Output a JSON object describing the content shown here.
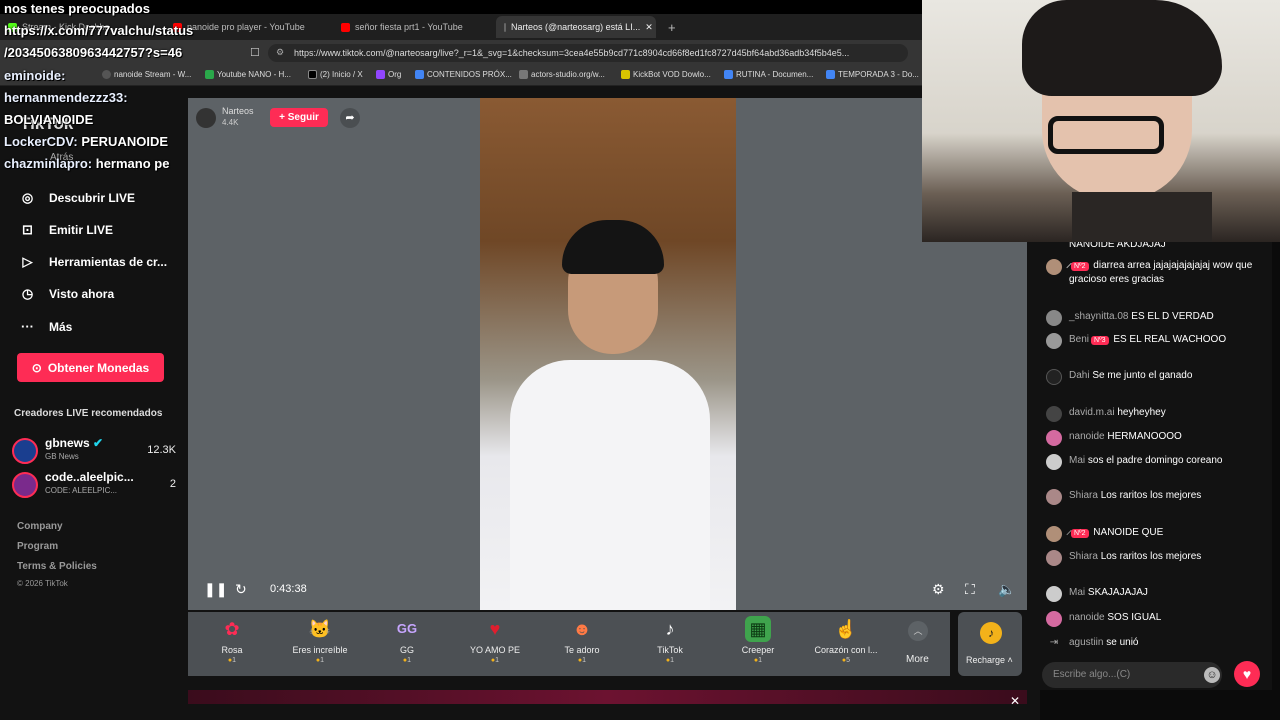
{
  "overlay": {
    "lines": [
      "nos tenes preocupados",
      "https://x.com/777valchu/status",
      "/2034506380963442757?s=46"
    ],
    "chat": [
      {
        "user": "eminoide:",
        "text": ""
      },
      {
        "user": "hernanmendezzz33:",
        "text": "BOLVIANOIDE"
      },
      {
        "user": "LockerCDV:",
        "text": "PERUANOIDE"
      },
      {
        "user": "chazminlapro:",
        "text": "hermano pe"
      }
    ]
  },
  "browser": {
    "tabs": [
      {
        "label": "Stream - Kick Dashbo..."
      },
      {
        "label": "nanoide pro player - YouTube"
      },
      {
        "label": "señor fiesta prt1 - YouTube"
      },
      {
        "label": "Narteos (@narteosarg) está LI..."
      }
    ],
    "url": "https://www.tiktok.com/@narteosarg/live?_r=1&_svg=1&checksum=3cea4e55b9cd771c8904cd66f8ed1fc8727d45bf64abd36adb34f5b4e5...",
    "bookmarks": [
      "nanoide Stream - W...",
      "Youtube NANO - H...",
      "(2) Inicio / X",
      "Org",
      "CONTENIDOS PRÓX...",
      "actors-studio.org/w...",
      "KickBot VOD Dowlo...",
      "RUTINA - Documen...",
      "TEMPORADA 3 - Do..."
    ]
  },
  "sidebar": {
    "logo": "TikTok",
    "back": "Atrás",
    "nav": [
      {
        "label": "Descubrir LIVE",
        "icon": "compass-icon"
      },
      {
        "label": "Emitir LIVE",
        "icon": "broadcast-icon"
      },
      {
        "label": "Herramientas de cr...",
        "icon": "lightbulb-icon"
      },
      {
        "label": "Visto ahora",
        "icon": "history-icon"
      },
      {
        "label": "Más",
        "icon": "more-icon"
      }
    ],
    "coins_button": "Obtener Monedas",
    "recommended_title": "Creadores LIVE recomendados",
    "creators": [
      {
        "name": "gbnews",
        "sub": "GB News",
        "count": "12.3K"
      },
      {
        "name": "code..aleelpic...",
        "sub": "CODE: ALEELPIC...",
        "count": "2"
      }
    ],
    "footer": [
      "Company",
      "Program",
      "Terms & Policies",
      "© 2026 TikTok"
    ]
  },
  "player": {
    "host_name": "Narteos",
    "host_likes": "4.4K",
    "follow_label": "+ Seguir",
    "time": "0:43:38"
  },
  "gifts": [
    {
      "name": "Rosa",
      "price": "1",
      "icon": "rose-icon"
    },
    {
      "name": "Eres increíble",
      "price": "1",
      "icon": "cat-icon"
    },
    {
      "name": "GG",
      "price": "1",
      "icon": "gg-icon"
    },
    {
      "name": "YO AMO PE",
      "price": "1",
      "icon": "heart-gift-icon"
    },
    {
      "name": "Te adoro",
      "price": "1",
      "icon": "kiss-icon"
    },
    {
      "name": "TikTok",
      "price": "1",
      "icon": "tiktok-icon"
    },
    {
      "name": "Creeper",
      "price": "1",
      "icon": "creeper-icon"
    },
    {
      "name": "Corazón con l...",
      "price": "5",
      "icon": "finger-heart-icon"
    }
  ],
  "more_label": "More",
  "recharge_label": "Recharge",
  "chat": {
    "messages": [
      {
        "user": "",
        "text": "NANOIDE AKDJAJAJ",
        "badge": ""
      },
      {
        "user": "̷̷̷",
        "text": "diarrea arrea jajajajajajajaj wow que gracioso eres gracias",
        "badge": "Nº2"
      },
      {
        "user": "_shaynitta.08",
        "text": "ES EL D VERDAD",
        "badge": ""
      },
      {
        "user": "Beni",
        "text": "ES EL REAL WACHOOO",
        "badge": "Nº3"
      },
      {
        "user": "Dahi",
        "text": "Se me junto el ganado",
        "badge": ""
      },
      {
        "user": "david.m.ai",
        "text": "heyheyhey",
        "badge": ""
      },
      {
        "user": "nanoide",
        "text": "HERMANOOOO",
        "badge": ""
      },
      {
        "user": "Mai",
        "text": "sos el padre domingo coreano",
        "badge": ""
      },
      {
        "user": "Shiara",
        "text": "Los raritos los mejores",
        "badge": ""
      },
      {
        "user": "̷",
        "text": "NANOIDE QUE",
        "badge": "Nº2"
      },
      {
        "user": "Shiara",
        "text": "Los raritos los mejores",
        "badge": ""
      },
      {
        "user": "Mai",
        "text": "SKAJAJAJAJ",
        "badge": ""
      },
      {
        "user": "nanoide",
        "text": "SOS IGUAL",
        "badge": ""
      },
      {
        "user": "agustiin",
        "text": "se unió",
        "badge": ""
      }
    ],
    "input_placeholder": "Escribe algo...(C)"
  },
  "colors": {
    "accent": "#fe2c55",
    "coin": "#f3b21a"
  }
}
